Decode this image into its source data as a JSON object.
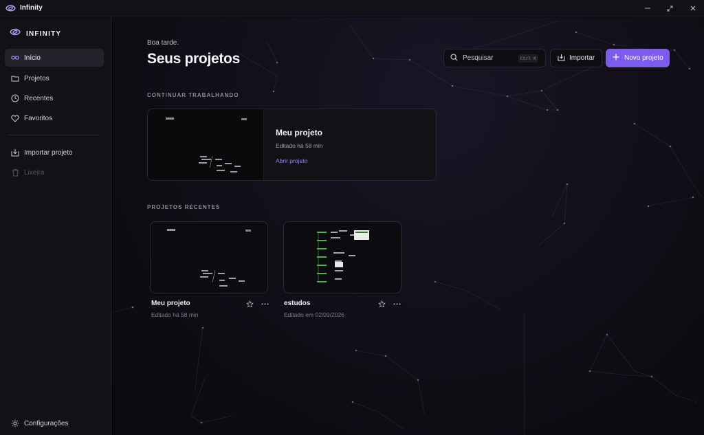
{
  "window": {
    "title": "Infinity"
  },
  "sidebar": {
    "brand": "INFINITY",
    "items": [
      {
        "label": "Início",
        "icon": "infinity-icon",
        "active": true
      },
      {
        "label": "Projetos",
        "icon": "folder-icon"
      },
      {
        "label": "Recentes",
        "icon": "clock-icon"
      },
      {
        "label": "Favoritos",
        "icon": "heart-icon"
      },
      {
        "label": "Importar projeto",
        "icon": "import-icon"
      },
      {
        "label": "Lixeira",
        "icon": "trash-icon",
        "disabled": true
      }
    ],
    "settings_label": "Configurações"
  },
  "header": {
    "greeting": "Boa tarde.",
    "title": "Seus projetos",
    "search_placeholder": "Pesquisar",
    "search_shortcut": "Ctrl K",
    "import_label": "Importar",
    "new_project_label": "Novo projeto"
  },
  "continue": {
    "section_label": "CONTINUAR TRABALHANDO",
    "title": "Meu projeto",
    "edited": "Editado há 58 min",
    "open_label": "Abrir projeto"
  },
  "recent": {
    "section_label": "PROJETOS RECENTES",
    "projects": [
      {
        "title": "Meu projeto",
        "edited": "Editado há 58 min"
      },
      {
        "title": "estudos",
        "edited": "Editado em 02/09/2026"
      }
    ]
  },
  "colors": {
    "accent": "#7c5cf0",
    "link": "#9d84f7",
    "background": "#0c0b10",
    "sidebar": "#121116"
  }
}
